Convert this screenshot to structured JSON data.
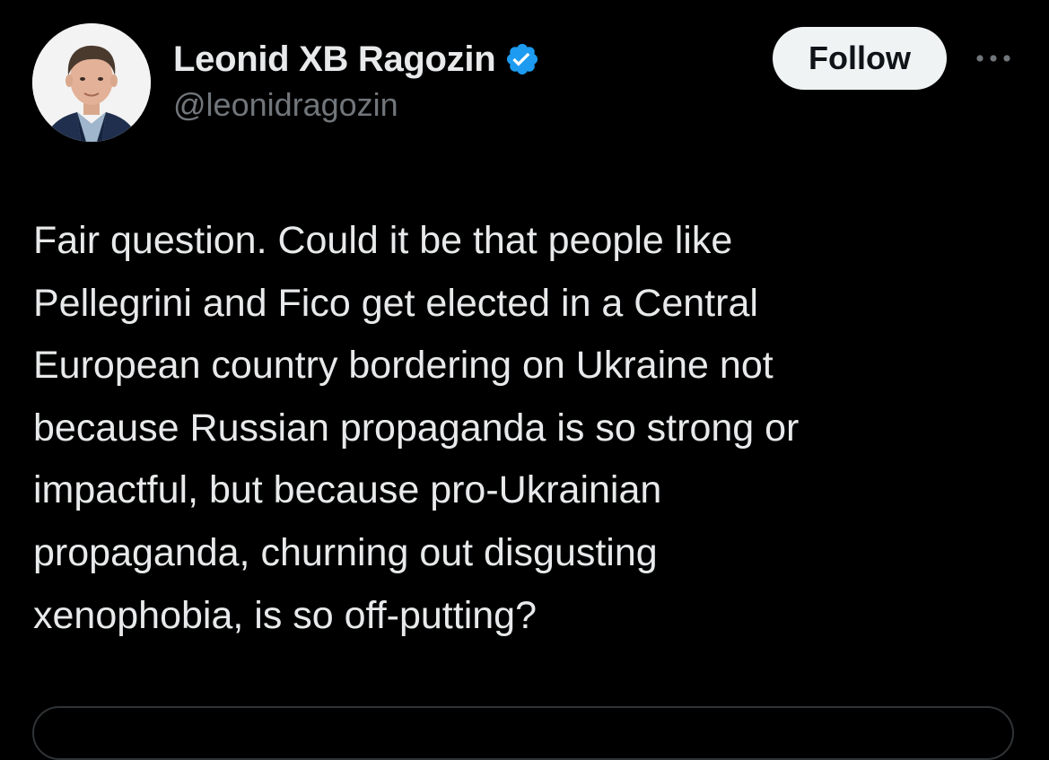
{
  "tweet": {
    "author": {
      "display_name": "Leonid XB Ragozin",
      "handle": "@leonidragozin",
      "verified": true,
      "avatar_icon": "profile-photo"
    },
    "follow_label": "Follow",
    "more_icon": "more-horizontal-icon",
    "text": "Fair question. Could it be that people like\nPellegrini and Fico get elected in a Central\nEuropean country bordering on Ukraine not\nbecause Russian propaganda is so strong or\nimpactful, but because pro-Ukrainian\npropaganda, churning out disgusting\nxenophobia, is so off-putting?"
  },
  "colors": {
    "background": "#000000",
    "text_primary": "#e7e9ea",
    "text_secondary": "#71767b",
    "verified_blue": "#1d9bf0",
    "follow_bg": "#eff3f4",
    "follow_text": "#0f1419",
    "border": "#2f3336"
  }
}
